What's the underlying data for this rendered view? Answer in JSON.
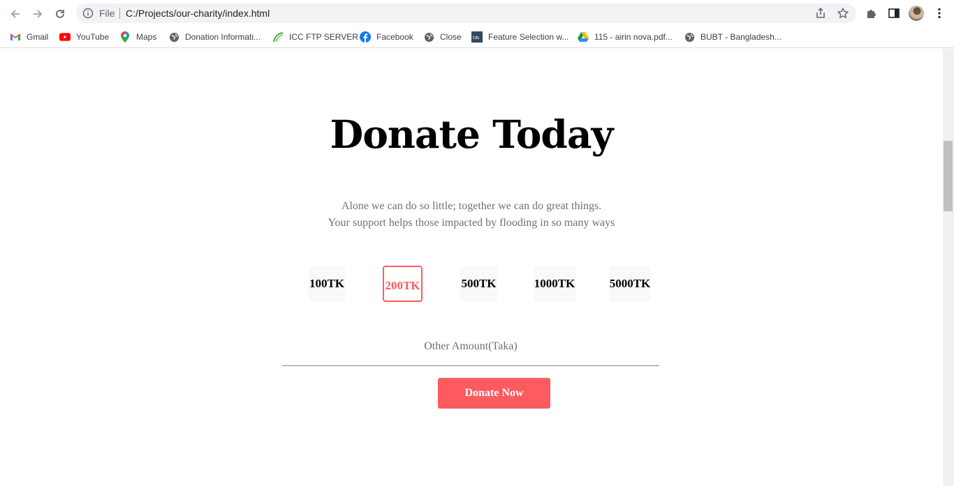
{
  "browser": {
    "omnibox": {
      "scheme_label": "File",
      "url": "C:/Projects/our-charity/index.html"
    },
    "bookmarks": [
      {
        "label": "Gmail",
        "icon": "gmail-icon"
      },
      {
        "label": "YouTube",
        "icon": "youtube-icon"
      },
      {
        "label": "Maps",
        "icon": "maps-icon"
      },
      {
        "label": "Donation Informati...",
        "icon": "globe-icon"
      },
      {
        "label": "ICC FTP SERVER",
        "icon": "icc-icon"
      },
      {
        "label": "Facebook",
        "icon": "facebook-icon"
      },
      {
        "label": "Close",
        "icon": "globe-icon"
      },
      {
        "label": "Feature Selection w...",
        "icon": "tds-icon"
      },
      {
        "label": "115 - airin nova.pdf...",
        "icon": "google-drive-icon"
      },
      {
        "label": "BUBT - Bangladesh...",
        "icon": "globe-icon"
      }
    ],
    "colors": {
      "youtube": "#ff0000",
      "facebook": "#1877f2"
    }
  },
  "page": {
    "title": "Donate Today",
    "tagline_line1": "Alone we can do so little; together we can do great things.",
    "tagline_line2": "Your support helps those impacted by flooding in so many ways",
    "amounts": [
      {
        "label": "100TK",
        "selected": false
      },
      {
        "label": "200TK",
        "selected": true
      },
      {
        "label": "500TK",
        "selected": false
      },
      {
        "label": "1000TK",
        "selected": false
      },
      {
        "label": "5000TK",
        "selected": false
      }
    ],
    "other_amount_label": "Other Amount(Taka)",
    "donate_button": "Donate Now",
    "accent_color": "#ff5a5f"
  }
}
